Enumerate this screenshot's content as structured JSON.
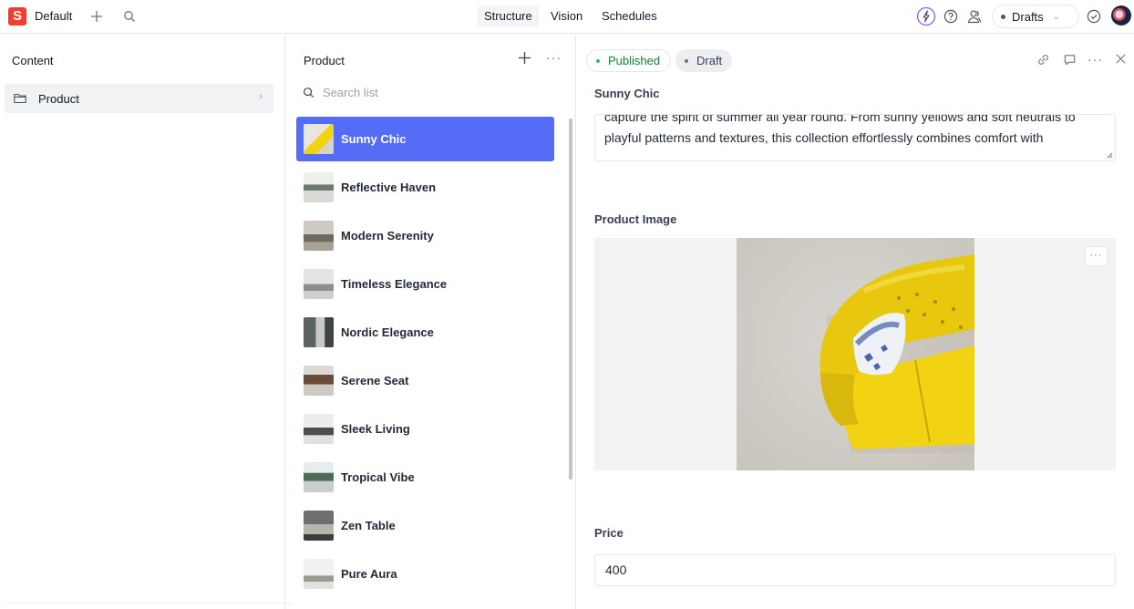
{
  "workspace": {
    "name": "Default",
    "logo_letter": "S"
  },
  "nav": {
    "tabs": [
      {
        "label": "Structure",
        "active": true
      },
      {
        "label": "Vision",
        "active": false
      },
      {
        "label": "Schedules",
        "active": false
      }
    ],
    "drafts_label": "Drafts"
  },
  "content_pane": {
    "title": "Content",
    "items": [
      {
        "label": "Product"
      }
    ]
  },
  "list_pane": {
    "title": "Product",
    "search_placeholder": "Search list",
    "items": [
      {
        "name": "Sunny Chic",
        "selected": true
      },
      {
        "name": "Reflective Haven",
        "selected": false
      },
      {
        "name": "Modern Serenity",
        "selected": false
      },
      {
        "name": "Timeless Elegance",
        "selected": false
      },
      {
        "name": "Nordic Elegance",
        "selected": false
      },
      {
        "name": "Serene Seat",
        "selected": false
      },
      {
        "name": "Sleek Living",
        "selected": false
      },
      {
        "name": "Tropical Vibe",
        "selected": false
      },
      {
        "name": "Zen Table",
        "selected": false
      },
      {
        "name": "Pure Aura",
        "selected": false
      }
    ]
  },
  "document": {
    "status_published": "Published",
    "status_draft": "Draft",
    "title": "Sunny Chic",
    "description": "capture the spirit of summer all year round. From sunny yellows and soft neutrals to playful patterns and textures, this collection effortlessly combines comfort with",
    "product_image_label": "Product Image",
    "price_label": "Price",
    "price_value": "400"
  },
  "colors": {
    "brand": "#f03e2f",
    "selection": "#556cf7",
    "published": "#22c55e",
    "sofa_yellow": "#f2d313"
  }
}
